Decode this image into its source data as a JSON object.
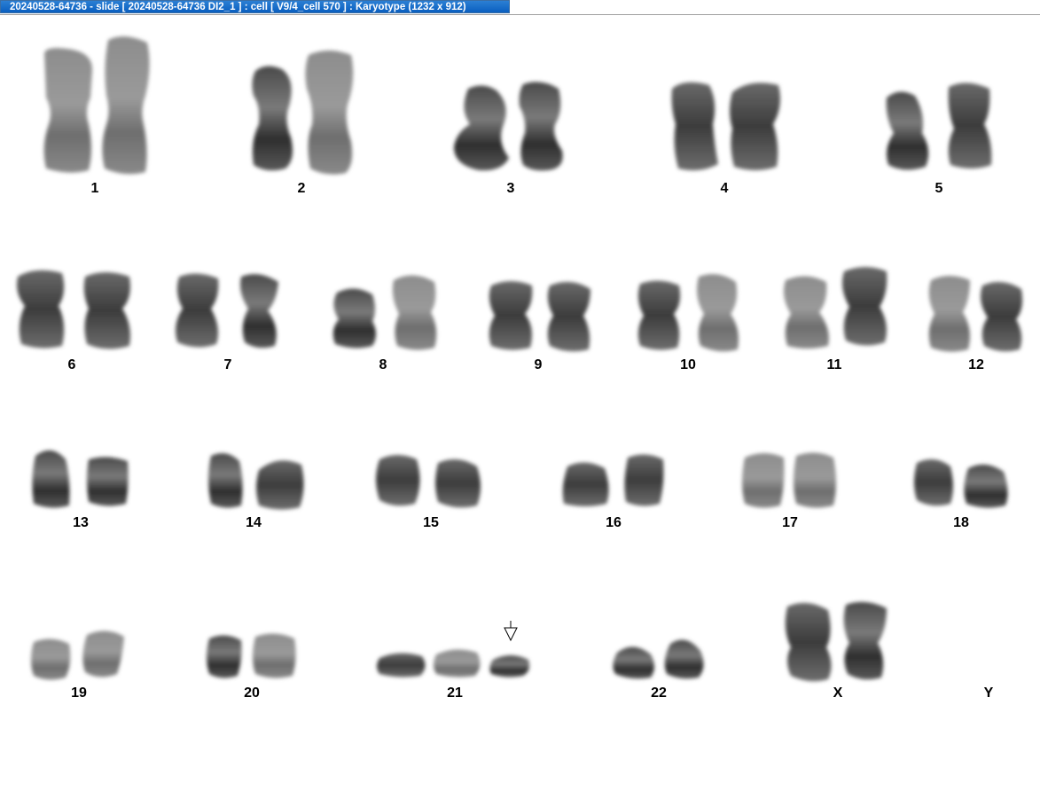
{
  "window": {
    "title": "20240528-64736 - slide [ 20240528-64736 DI2_1 ] : cell [ V9/4_cell 570 ] : Karyotype  (1232 x 912)"
  },
  "karyotype": {
    "labels": {
      "c1": "1",
      "c2": "2",
      "c3": "3",
      "c4": "4",
      "c5": "5",
      "c6": "6",
      "c7": "7",
      "c8": "8",
      "c9": "9",
      "c10": "10",
      "c11": "11",
      "c12": "12",
      "c13": "13",
      "c14": "14",
      "c15": "15",
      "c16": "16",
      "c17": "17",
      "c18": "18",
      "c19": "19",
      "c20": "20",
      "c21": "21",
      "c22": "22",
      "cX": "X",
      "cY": "Y"
    },
    "marker": "arrow-down-outline-icon"
  }
}
